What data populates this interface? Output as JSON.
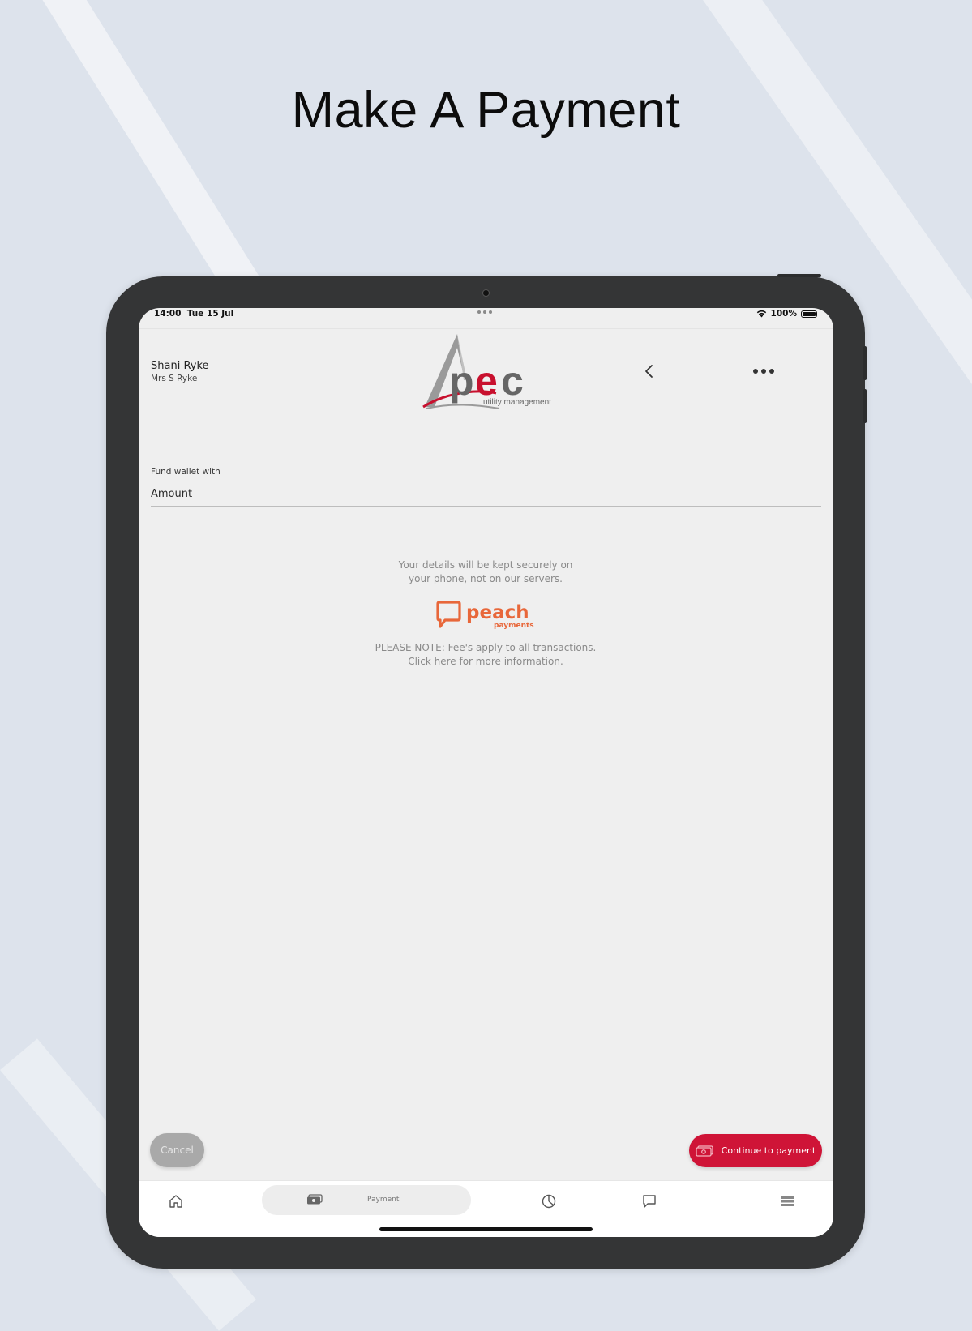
{
  "page": {
    "headline": "Make A Payment"
  },
  "statusbar": {
    "time": "14:00",
    "date": "Tue 15 Jul",
    "battery": "100%"
  },
  "header": {
    "user_name": "Shani Ryke",
    "user_subtitle": "Mrs S Ryke",
    "logo_text": "pec",
    "logo_tagline": "utility management",
    "back_icon": "chevron-left-icon",
    "more_icon": "more-horizontal-icon"
  },
  "form": {
    "field_label": "Fund wallet with",
    "amount_placeholder": "Amount",
    "amount_value": ""
  },
  "info": {
    "secure_line1": "Your details will be kept securely on",
    "secure_line2": "your phone, not on our servers.",
    "provider_name": "peach",
    "provider_sub": "payments",
    "note_line1": "PLEASE NOTE: Fee's apply to all transactions.",
    "note_line2": "Click here for more information."
  },
  "actions": {
    "cancel_label": "Cancel",
    "continue_label": "Continue to payment",
    "continue_icon": "cash-icon"
  },
  "nav": {
    "items": [
      {
        "icon": "home-icon",
        "label": ""
      },
      {
        "icon": "cash-icon",
        "label": "Payment",
        "active": true
      },
      {
        "icon": "pie-chart-icon",
        "label": ""
      },
      {
        "icon": "chat-icon",
        "label": ""
      },
      {
        "icon": "menu-icon",
        "label": ""
      }
    ]
  },
  "colors": {
    "accent": "#cf1437",
    "peach": "#e8673a",
    "background": "#dde3ec",
    "device": "#343536",
    "screen": "#efefef"
  }
}
